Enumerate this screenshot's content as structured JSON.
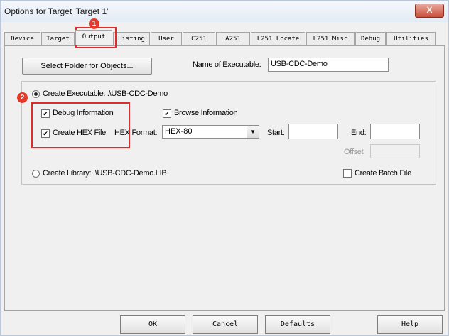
{
  "window": {
    "title": "Options for Target 'Target 1'",
    "close_label": "X"
  },
  "tabs": [
    {
      "label": "Device"
    },
    {
      "label": "Target"
    },
    {
      "label": "Output"
    },
    {
      "label": "Listing"
    },
    {
      "label": "User"
    },
    {
      "label": "C251"
    },
    {
      "label": "A251"
    },
    {
      "label": "L251 Locate"
    },
    {
      "label": "L251 Misc"
    },
    {
      "label": "Debug"
    },
    {
      "label": "Utilities"
    }
  ],
  "output": {
    "select_folder_label": "Select Folder for Objects...",
    "name_exec_label": "Name of Executable:",
    "name_exec_value": "USB-CDC-Demo",
    "create_exec_label": "Create Executable:  .\\USB-CDC-Demo",
    "debug_info_label": "Debug Information",
    "browse_info_label": "Browse Information",
    "create_hex_label": "Create HEX File",
    "hex_format_label": "HEX Format:",
    "hex_format_value": "HEX-80",
    "start_label": "Start:",
    "start_value": "",
    "end_label": "End:",
    "end_value": "",
    "offset_label": "Offset",
    "offset_value": "",
    "create_library_label": "Create Library:  .\\USB-CDC-Demo.LIB",
    "create_batch_label": "Create Batch File",
    "checkbox_mark": "✔"
  },
  "annotations": {
    "badge_1": "1",
    "badge_2": "2"
  },
  "buttons": {
    "ok": "OK",
    "cancel": "Cancel",
    "defaults": "Defaults",
    "help": "Help"
  },
  "colors": {
    "highlight": "#e02b2b",
    "window_bg": "#f0f0f0"
  }
}
